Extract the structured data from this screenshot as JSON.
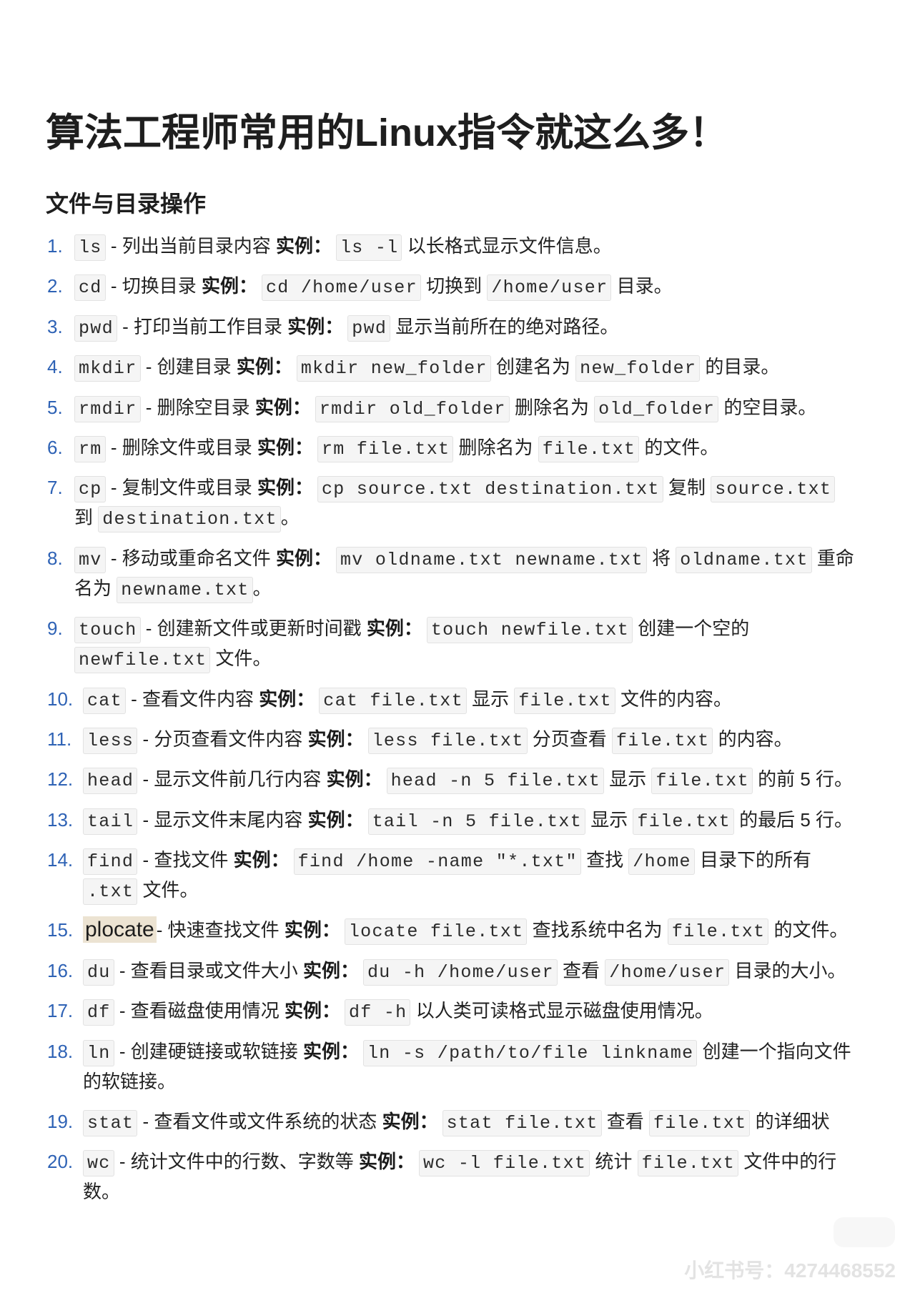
{
  "document": {
    "title": "算法工程师常用的Linux指令就这么多！",
    "section_heading": "文件与目录操作",
    "items": [
      {
        "number": "1.",
        "lines": [
          [
            {
              "code": "ls"
            },
            {
              "text": " - 列出当前目录内容 "
            },
            {
              "bold": "实例："
            },
            {
              "code": "ls -l"
            },
            {
              "text": " 以长格式显示文件信息。"
            }
          ]
        ]
      },
      {
        "number": "2.",
        "lines": [
          [
            {
              "code": "cd"
            },
            {
              "text": " - 切换目录 "
            },
            {
              "bold": "实例："
            },
            {
              "code": "cd /home/user"
            },
            {
              "text": " 切换到 "
            },
            {
              "code": "/home/user"
            },
            {
              "text": " 目录。"
            }
          ]
        ]
      },
      {
        "number": "3.",
        "lines": [
          [
            {
              "code": "pwd"
            },
            {
              "text": " - 打印当前工作目录 "
            },
            {
              "bold": "实例："
            },
            {
              "code": "pwd"
            },
            {
              "text": " 显示当前所在的绝对路径。"
            }
          ]
        ]
      },
      {
        "number": "4.",
        "lines": [
          [
            {
              "code": "mkdir"
            },
            {
              "text": " - 创建目录 "
            },
            {
              "bold": "实例："
            },
            {
              "code": "mkdir new_folder"
            },
            {
              "text": " 创建名为 "
            },
            {
              "code": "new_folder"
            },
            {
              "text": " 的目录。"
            }
          ]
        ]
      },
      {
        "number": "5.",
        "lines": [
          [
            {
              "code": "rmdir"
            },
            {
              "text": " - 删除空目录 "
            },
            {
              "bold": "实例："
            },
            {
              "code": "rmdir old_folder"
            },
            {
              "text": " 删除名为 "
            },
            {
              "code": "old_folder"
            },
            {
              "text": " 的空目录。"
            }
          ]
        ]
      },
      {
        "number": "6.",
        "lines": [
          [
            {
              "code": "rm"
            },
            {
              "text": " - 删除文件或目录 "
            },
            {
              "bold": "实例："
            },
            {
              "code": "rm file.txt"
            },
            {
              "text": " 删除名为 "
            },
            {
              "code": "file.txt"
            },
            {
              "text": " 的文件。"
            }
          ]
        ]
      },
      {
        "number": "7.",
        "lines": [
          [
            {
              "code": "cp"
            },
            {
              "text": " - 复制文件或目录 "
            },
            {
              "bold": "实例："
            },
            {
              "code": "cp source.txt destination.txt"
            },
            {
              "text": " 复制 "
            },
            {
              "code": "source.txt"
            }
          ],
          [
            {
              "text": "到 "
            },
            {
              "code": "destination.txt"
            },
            {
              "text": "。"
            }
          ]
        ]
      },
      {
        "number": "8.",
        "lines": [
          [
            {
              "code": "mv"
            },
            {
              "text": " - 移动或重命名文件 "
            },
            {
              "bold": "实例："
            },
            {
              "code": "mv oldname.txt newname.txt"
            },
            {
              "text": " 将 "
            },
            {
              "code": "oldname.txt"
            },
            {
              "text": " 重命"
            }
          ],
          [
            {
              "text": "名为 "
            },
            {
              "code": "newname.txt"
            },
            {
              "text": "。"
            }
          ]
        ]
      },
      {
        "number": "9.",
        "lines": [
          [
            {
              "code": "touch"
            },
            {
              "text": " - 创建新文件或更新时间戳 "
            },
            {
              "bold": "实例："
            },
            {
              "code": "touch newfile.txt"
            },
            {
              "text": " 创建一个空的"
            }
          ],
          [
            {
              "code": "newfile.txt"
            },
            {
              "text": " 文件。"
            }
          ]
        ]
      },
      {
        "number": "10.",
        "lines": [
          [
            {
              "code": "cat"
            },
            {
              "text": " - 查看文件内容 "
            },
            {
              "bold": "实例："
            },
            {
              "code": "cat file.txt"
            },
            {
              "text": " 显示 "
            },
            {
              "code": "file.txt"
            },
            {
              "text": " 文件的内容。"
            }
          ]
        ]
      },
      {
        "number": "11.",
        "lines": [
          [
            {
              "code": "less"
            },
            {
              "text": " - 分页查看文件内容 "
            },
            {
              "bold": "实例："
            },
            {
              "code": "less file.txt"
            },
            {
              "text": " 分页查看 "
            },
            {
              "code": "file.txt"
            },
            {
              "text": " 的内容。"
            }
          ]
        ]
      },
      {
        "number": "12.",
        "lines": [
          [
            {
              "code": "head"
            },
            {
              "text": " - 显示文件前几行内容 "
            },
            {
              "bold": "实例："
            },
            {
              "code": "head -n 5 file.txt"
            },
            {
              "text": " 显示 "
            },
            {
              "code": "file.txt"
            },
            {
              "text": " 的前 5 行。"
            }
          ]
        ]
      },
      {
        "number": "13.",
        "lines": [
          [
            {
              "code": "tail"
            },
            {
              "text": " - 显示文件末尾内容 "
            },
            {
              "bold": "实例："
            },
            {
              "code": "tail -n 5 file.txt"
            },
            {
              "text": " 显示 "
            },
            {
              "code": "file.txt"
            },
            {
              "text": " 的最后 5 行。"
            }
          ]
        ]
      },
      {
        "number": "14.",
        "lines": [
          [
            {
              "code": "find"
            },
            {
              "text": " - 查找文件 "
            },
            {
              "bold": "实例："
            },
            {
              "code": "find /home -name \"*.txt\""
            },
            {
              "text": " 查找 "
            },
            {
              "code": "/home"
            },
            {
              "text": " 目录下的所有"
            }
          ],
          [
            {
              "code": ".txt"
            },
            {
              "text": " 文件。"
            }
          ]
        ]
      },
      {
        "number": "15.",
        "lines": [
          [
            {
              "mark": "plocate"
            },
            {
              "text": "- 快速查找文件 "
            },
            {
              "bold": "实例："
            },
            {
              "code": "locate file.txt"
            },
            {
              "text": " 查找系统中名为 "
            },
            {
              "code": "file.txt"
            },
            {
              "text": " 的文件。"
            }
          ]
        ]
      },
      {
        "number": "16.",
        "lines": [
          [
            {
              "code": "du"
            },
            {
              "text": " - 查看目录或文件大小 "
            },
            {
              "bold": "实例："
            },
            {
              "code": "du -h /home/user"
            },
            {
              "text": " 查看 "
            },
            {
              "code": "/home/user"
            },
            {
              "text": " 目录的大小。"
            }
          ]
        ]
      },
      {
        "number": "17.",
        "lines": [
          [
            {
              "code": "df"
            },
            {
              "text": " - 查看磁盘使用情况 "
            },
            {
              "bold": "实例："
            },
            {
              "code": "df -h"
            },
            {
              "text": " 以人类可读格式显示磁盘使用情况。"
            }
          ]
        ]
      },
      {
        "number": "18.",
        "lines": [
          [
            {
              "code": "ln"
            },
            {
              "text": " - 创建硬链接或软链接 "
            },
            {
              "bold": "实例："
            },
            {
              "code": "ln -s /path/to/file linkname"
            },
            {
              "text": " 创建一个指向文件"
            }
          ],
          [
            {
              "text": "的软链接。"
            }
          ]
        ]
      },
      {
        "number": "19.",
        "lines": [
          [
            {
              "code": "stat"
            },
            {
              "text": " - 查看文件或文件系统的状态 "
            },
            {
              "bold": "实例："
            },
            {
              "code": "stat file.txt"
            },
            {
              "text": " 查看 "
            },
            {
              "code": "file.txt"
            },
            {
              "text": " 的详细状"
            }
          ]
        ]
      },
      {
        "number": "20.",
        "lines": [
          [
            {
              "code": "wc"
            },
            {
              "text": " - 统计文件中的行数、字数等 "
            },
            {
              "bold": "实例："
            },
            {
              "code": "wc -l file.txt"
            },
            {
              "text": " 统计 "
            },
            {
              "code": "file.txt"
            },
            {
              "text": " 文件中的行"
            }
          ],
          [
            {
              "text": "数。"
            }
          ]
        ]
      }
    ]
  },
  "watermark": {
    "text": "小红书号：4274468552"
  },
  "colors": {
    "number": "#2e62b5",
    "code_bg": "#f5f5f5",
    "code_border": "#e2e2e2",
    "highlight_bg": "#ece3d2",
    "watermark": "#e3e3e3"
  }
}
